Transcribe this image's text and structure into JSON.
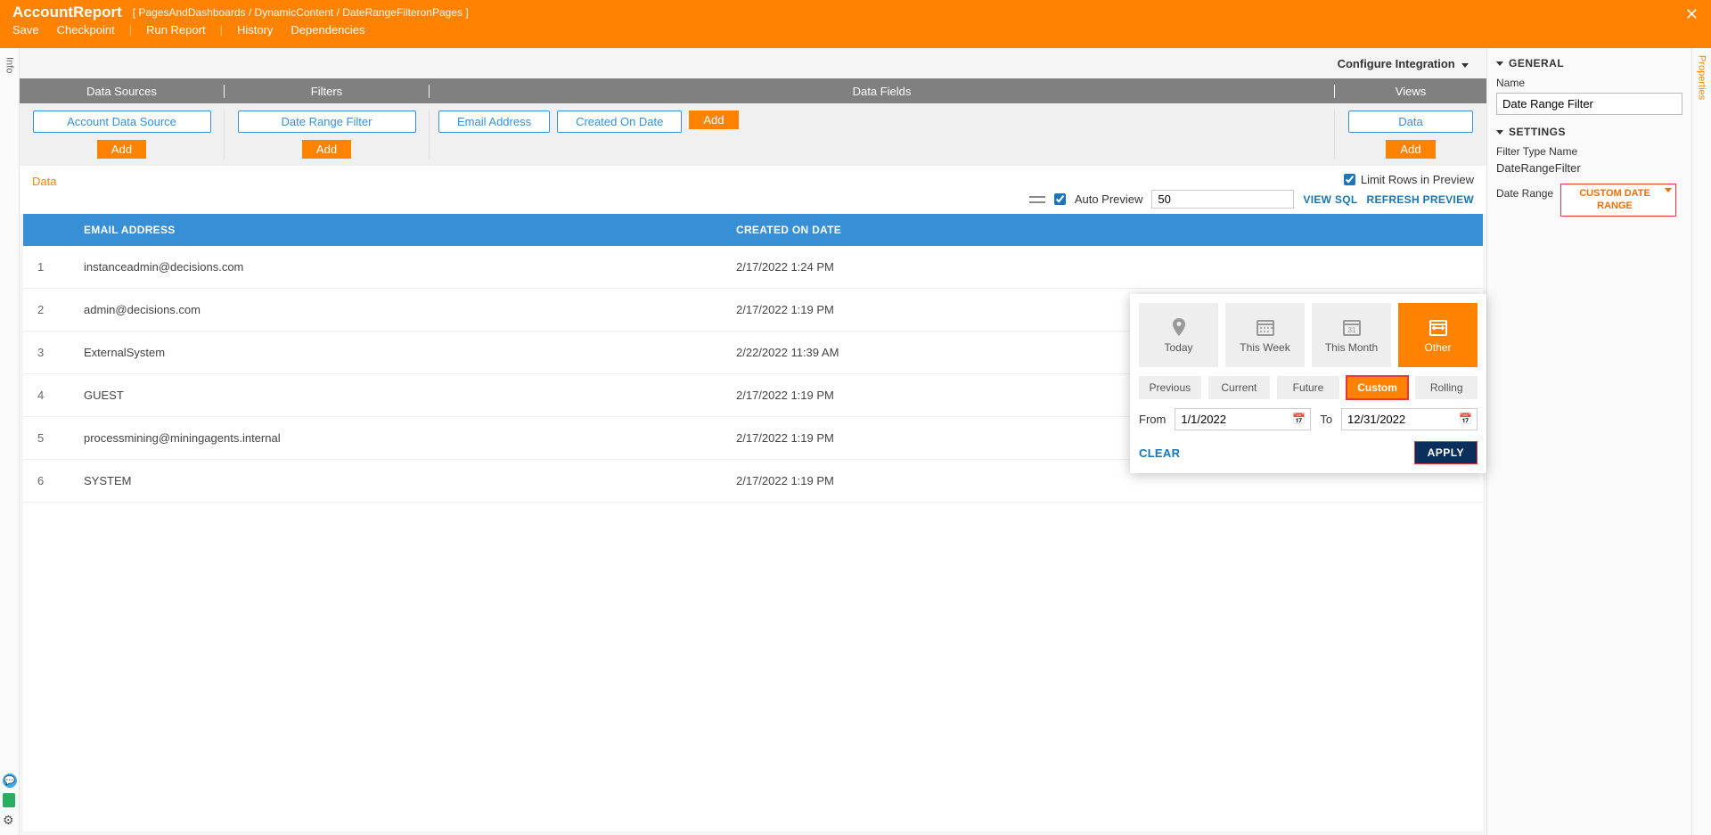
{
  "header": {
    "title": "AccountReport",
    "breadcrumb": "[ PagesAndDashboards / DynamicContent / DateRangeFilteronPages ]",
    "menu": {
      "save": "Save",
      "checkpoint": "Checkpoint",
      "run": "Run Report",
      "history": "History",
      "deps": "Dependencies"
    }
  },
  "info_tab": "Info",
  "prop_tab": "Properties",
  "config_integration": "Configure Integration",
  "sections": {
    "data_sources": "Data Sources",
    "filters": "Filters",
    "data_fields": "Data Fields",
    "views": "Views"
  },
  "chips": {
    "account_ds": "Account Data Source",
    "date_range_filter": "Date Range Filter",
    "email": "Email Address",
    "created": "Created On Date",
    "data_view": "Data",
    "add": "Add"
  },
  "preview": {
    "label": "Data",
    "limit_rows": "Limit Rows in Preview",
    "auto": "Auto Preview",
    "rows_value": "50",
    "view_sql": "VIEW SQL",
    "refresh": "REFRESH PREVIEW"
  },
  "table": {
    "headers": {
      "email": "EMAIL ADDRESS",
      "created": "CREATED ON DATE"
    },
    "rows": [
      {
        "n": "1",
        "email": "instanceadmin@decisions.com",
        "date": "2/17/2022 1:24 PM"
      },
      {
        "n": "2",
        "email": "admin@decisions.com",
        "date": "2/17/2022 1:19 PM"
      },
      {
        "n": "3",
        "email": "ExternalSystem",
        "date": "2/22/2022 11:39 AM"
      },
      {
        "n": "4",
        "email": "GUEST",
        "date": "2/17/2022 1:19 PM"
      },
      {
        "n": "5",
        "email": "processmining@miningagents.internal",
        "date": "2/17/2022 1:19 PM"
      },
      {
        "n": "6",
        "email": "SYSTEM",
        "date": "2/17/2022 1:19 PM"
      }
    ]
  },
  "right": {
    "general": "GENERAL",
    "name_lbl": "Name",
    "name_val": "Date Range Filter",
    "settings": "SETTINGS",
    "filter_type_lbl": "Filter Type Name",
    "filter_type_val": "DateRangeFilter",
    "date_range_lbl": "Date Range",
    "dr_value": "CUSTOM DATE RANGE"
  },
  "popover": {
    "tiles": {
      "today": "Today",
      "week": "This Week",
      "month": "This Month",
      "other": "Other"
    },
    "segs": {
      "prev": "Previous",
      "curr": "Current",
      "fut": "Future",
      "cust": "Custom",
      "roll": "Rolling"
    },
    "from_lbl": "From",
    "to_lbl": "To",
    "from_val": "1/1/2022",
    "to_val": "12/31/2022",
    "clear": "CLEAR",
    "apply": "APPLY"
  }
}
